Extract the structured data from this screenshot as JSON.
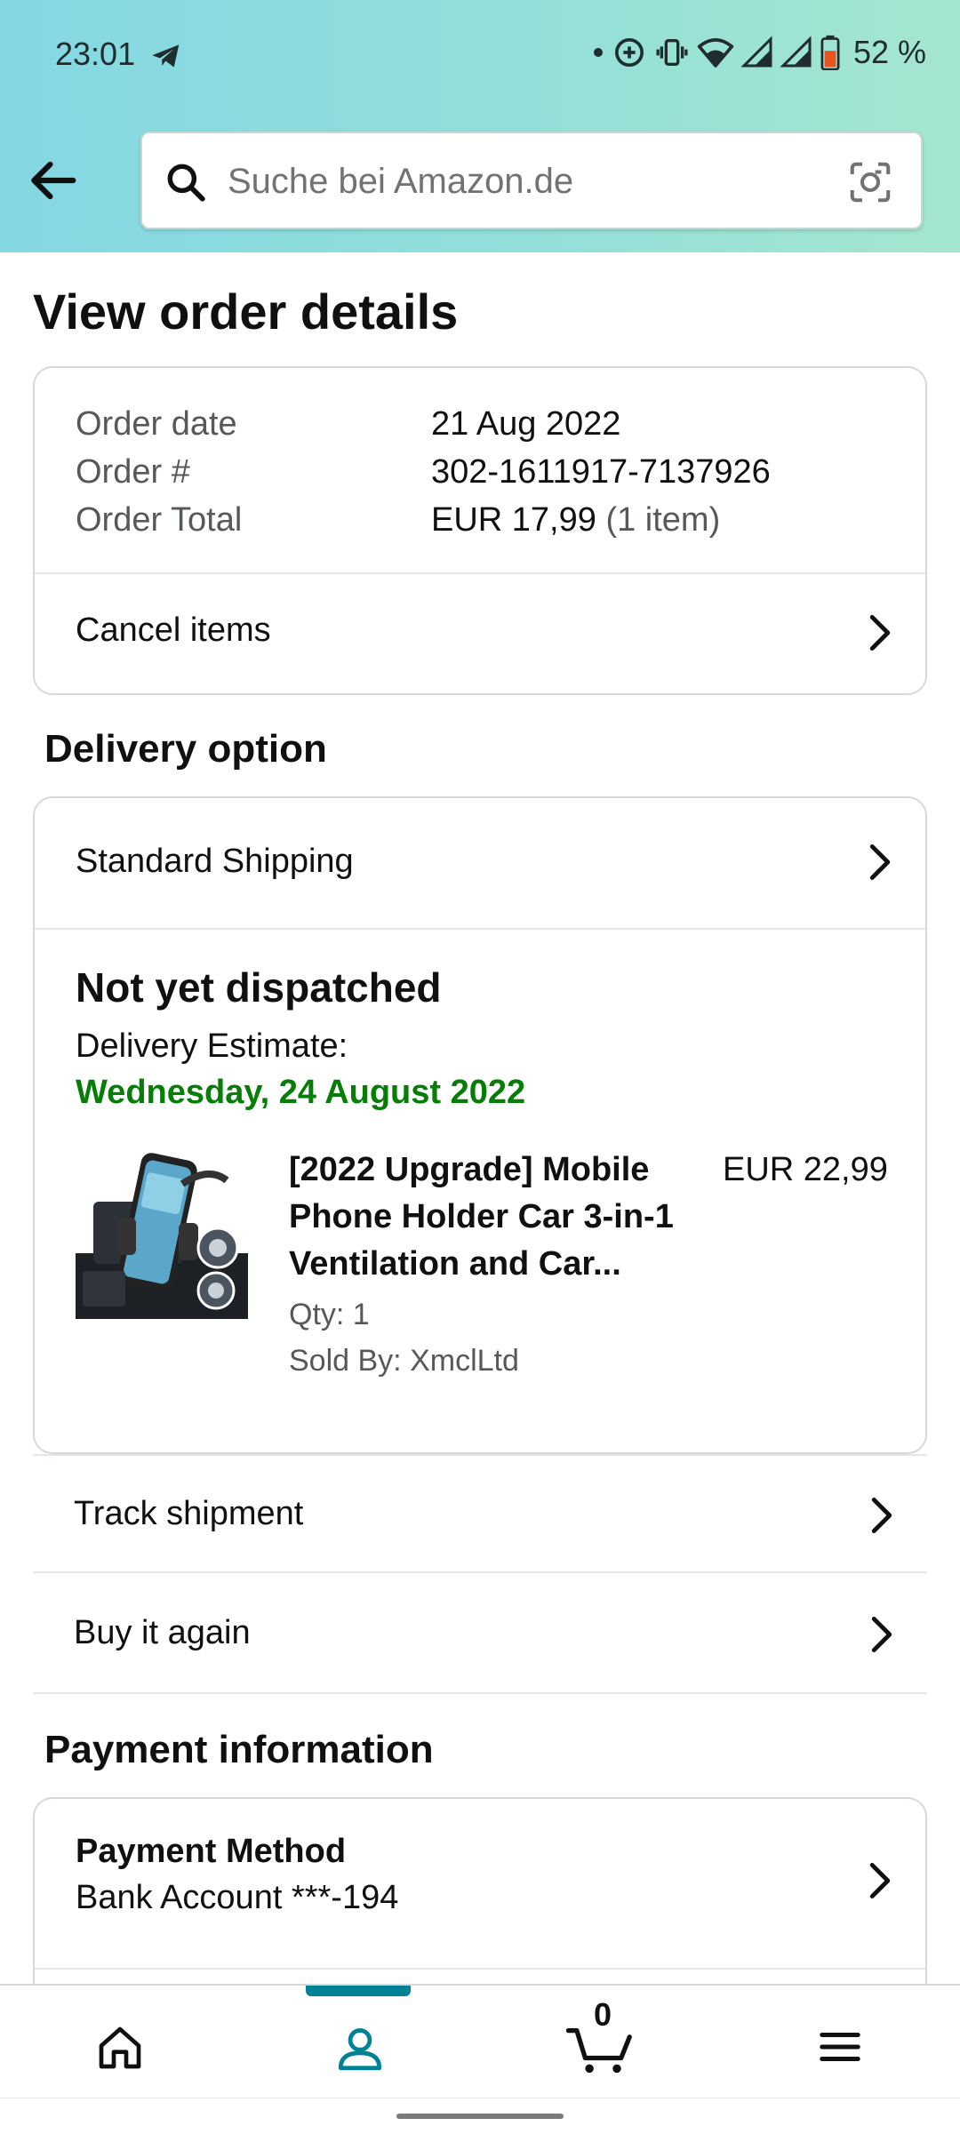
{
  "status_bar": {
    "time": "23:01",
    "battery": "52 %"
  },
  "search": {
    "placeholder": "Suche bei Amazon.de"
  },
  "page_title": "View order details",
  "order_summary": {
    "rows": [
      {
        "label": "Order date",
        "value": "21 Aug 2022"
      },
      {
        "label": "Order #",
        "value": "302-1611917-7137926"
      },
      {
        "label": "Order Total",
        "value": "EUR 17,99",
        "extra": "(1 item)"
      }
    ],
    "cancel_label": "Cancel items"
  },
  "delivery": {
    "section_title": "Delivery option",
    "shipping_label": "Standard Shipping",
    "status": "Not yet dispatched",
    "estimate_label": "Delivery Estimate:",
    "estimate_date": "Wednesday, 24 August 2022",
    "item": {
      "title": "[2022 Upgrade] Mobile Phone Holder Car 3-in-1 Ventilation and Car...",
      "price": "EUR 22,99",
      "qty": "Qty: 1",
      "sold_by": "Sold By: XmclLtd"
    }
  },
  "actions": {
    "track": "Track shipment",
    "buy_again": "Buy it again"
  },
  "payment": {
    "section_title": "Payment information",
    "method_title": "Payment Method",
    "method_value": "Bank Account ***-194"
  },
  "bottom_nav": {
    "cart_count": "0",
    "active": "account"
  },
  "colors": {
    "header_gradient_start": "#84d8e3",
    "header_gradient_end": "#a5e6d0",
    "delivery_green": "#067d06",
    "active_nav": "#008296"
  }
}
